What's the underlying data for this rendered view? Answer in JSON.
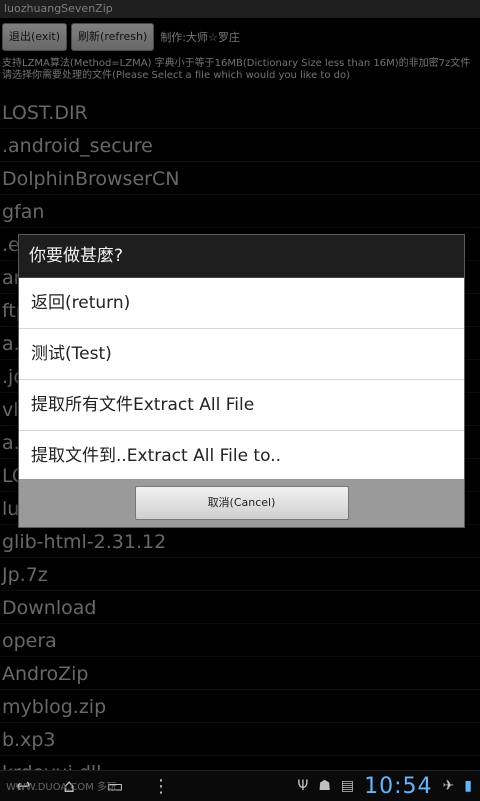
{
  "app": {
    "title": "luozhuangSevenZip"
  },
  "toolbar": {
    "exit_label": "退出(exit)",
    "refresh_label": "刷新(refresh)",
    "author": "制作:大师☆罗庄"
  },
  "info": {
    "line1": "支持LZMA算法(Method=LZMA) 字典小于等于16MB(Dictionary Size less than 16M)的非加密7z文件",
    "line2": "请选择你需要处理的文件(Please Select a file which would you like to do)"
  },
  "files": [
    "LOST.DIR",
    ".android_secure",
    "DolphinBrowserCN",
    "gfan",
    ".e",
    "ar",
    "ftp",
    "a.",
    ".jo",
    "vlc",
    "a.",
    "LO",
    "lu",
    "glib-html-2.31.12",
    "Jp.7z",
    "Download",
    "opera",
    "AndroZip",
    "myblog.zip",
    "b.xp3",
    "krdevui.dll"
  ],
  "dialog": {
    "title": "你要做甚麼?",
    "options": [
      "返回(return)",
      "测试(Test)",
      "提取所有文件Extract All File",
      "提取文件到..Extract All File to.."
    ],
    "cancel_label": "取消(Cancel)"
  },
  "navbar": {
    "watermark": "WWW.DUOA.COM 多玩",
    "time": "10:54",
    "icons": [
      "back-icon",
      "home-icon",
      "recent-apps-icon",
      "menu-icon",
      "usb-icon",
      "android-debug-icon",
      "sd-card-icon",
      "airplane-icon",
      "battery-icon"
    ]
  },
  "colors": {
    "clock": "#5fb7ff",
    "dialog_title_bg": "#1e1e1e"
  }
}
